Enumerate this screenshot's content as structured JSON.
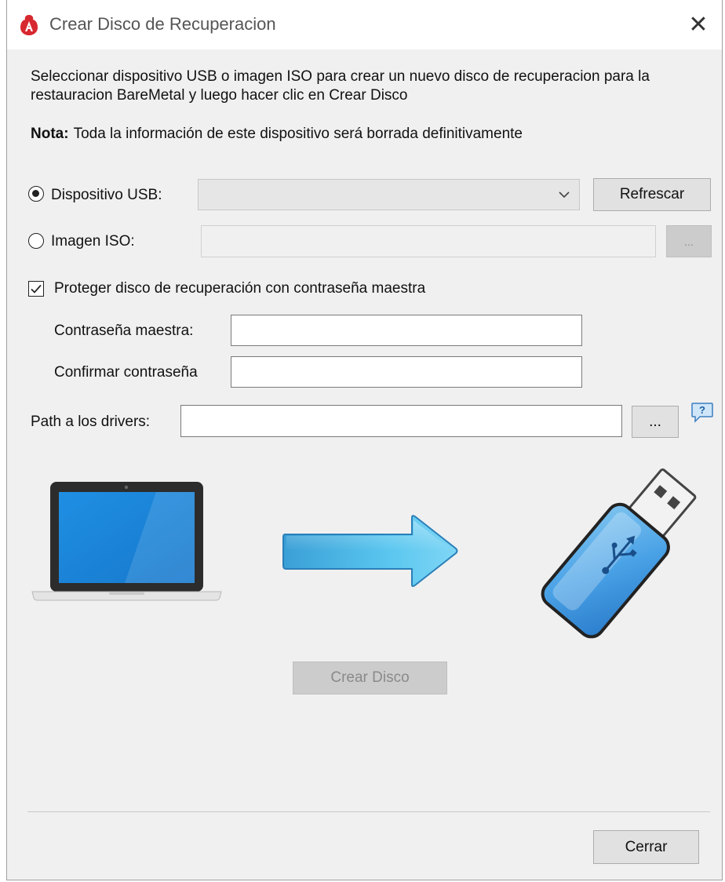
{
  "window": {
    "title": "Crear Disco de Recuperacion",
    "close_glyph": "✕"
  },
  "instruction": "Seleccionar dispositivo USB o imagen ISO para crear un nuevo disco de recuperacion para la restauracion BareMetal y luego hacer clic en Crear Disco",
  "note": {
    "label": "Nota:",
    "text": "Toda la información de este dispositivo será borrada definitivamente"
  },
  "source": {
    "usb_label": "Dispositivo USB:",
    "usb_selected": true,
    "usb_value": "",
    "refresh_label": "Refrescar",
    "iso_label": "Imagen ISO:",
    "iso_selected": false,
    "iso_value": "",
    "iso_browse_label": "..."
  },
  "protect": {
    "label": "Proteger disco de recuperación con contraseña maestra",
    "checked": true,
    "master_label": "Contraseña maestra:",
    "master_value": "",
    "confirm_label": "Confirmar contraseña",
    "confirm_value": ""
  },
  "drivers": {
    "label": "Path a los drivers:",
    "value": "",
    "browse_label": "..."
  },
  "illustration": {
    "source_icon": "laptop-icon",
    "arrow_icon": "arrow-right-icon",
    "target_icon": "usb-drive-icon"
  },
  "actions": {
    "create_label": "Crear Disco",
    "close_label": "Cerrar"
  },
  "colors": {
    "brand_red": "#d7282f",
    "screen_blue": "#1e8ce0",
    "arrow_blue": "#4bb8e8",
    "usb_blue": "#3a8fd8"
  }
}
